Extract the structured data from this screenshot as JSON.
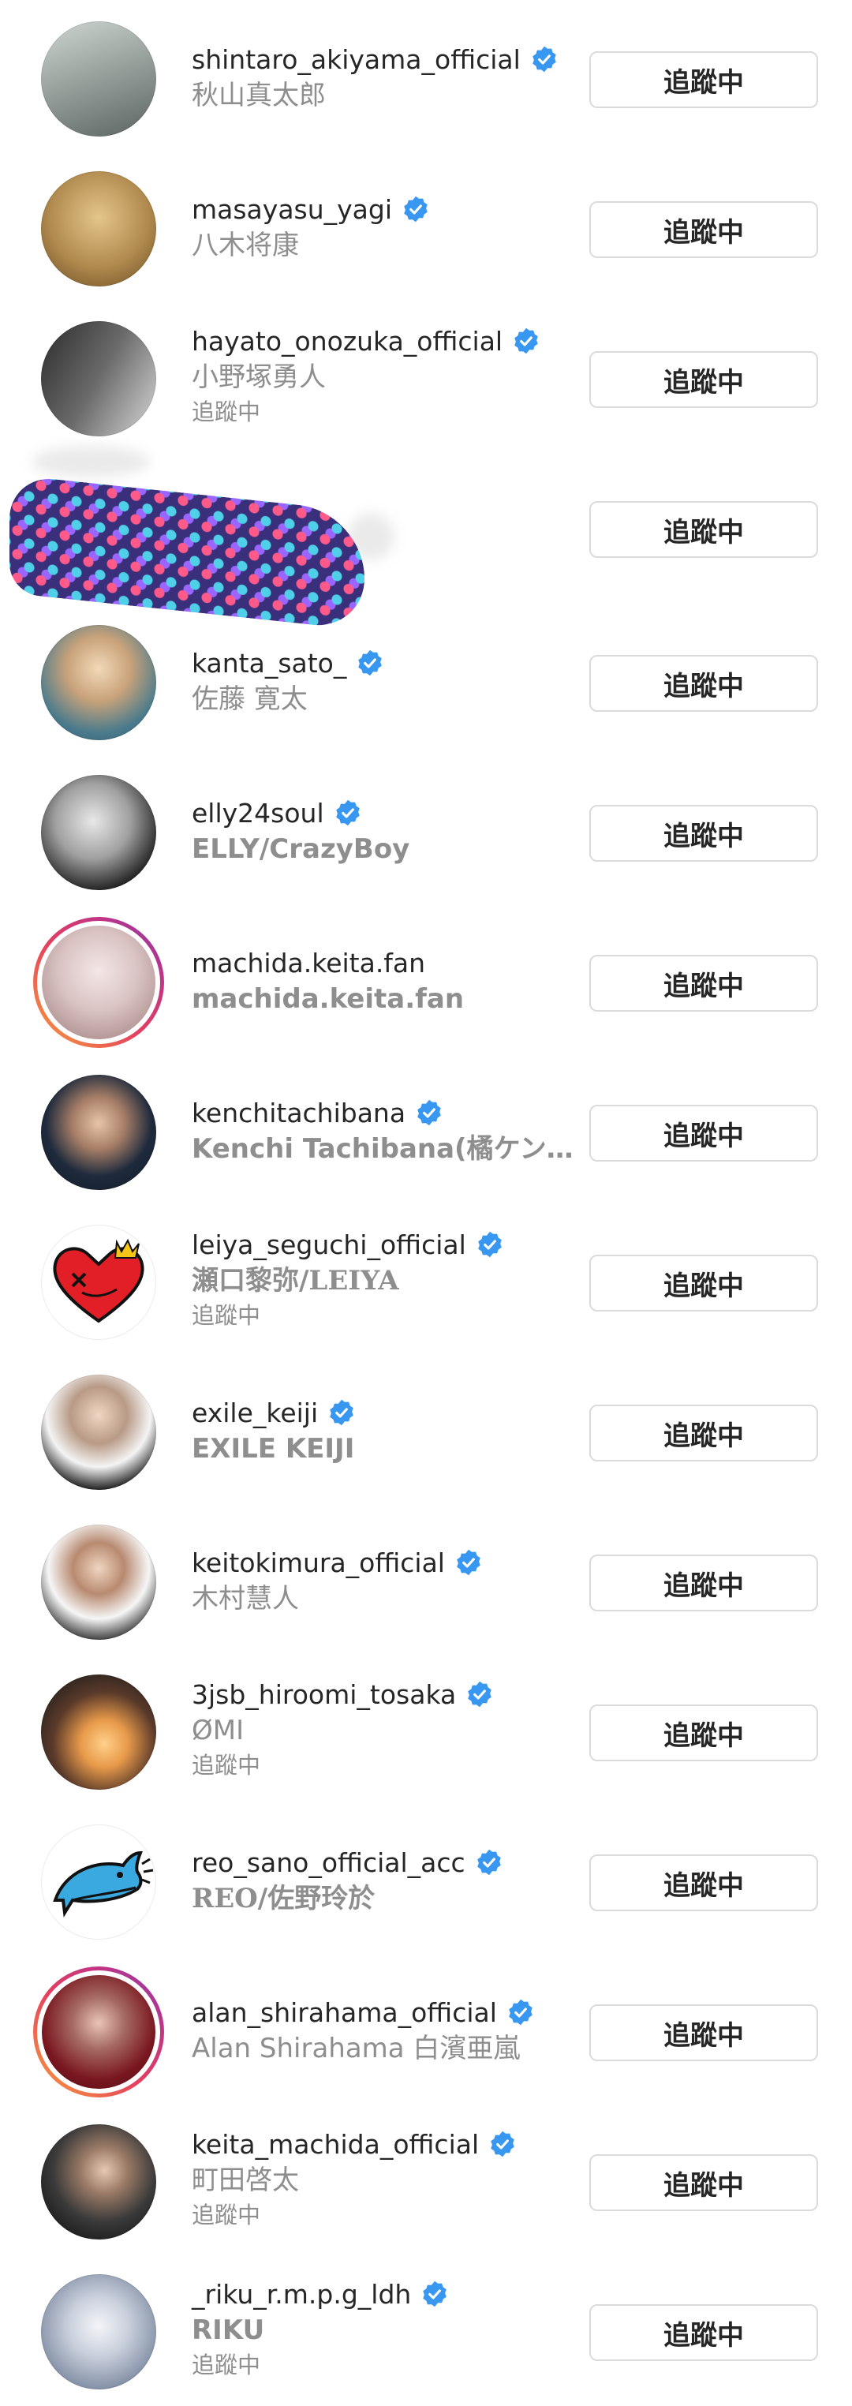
{
  "accent": {
    "verified": "#3897f0",
    "button_border": "#dbdbdb",
    "secondary_text": "#8e8e8e"
  },
  "rows": [
    {
      "username": "shintaro_akiyama_official",
      "fullname": "秋山真太郎",
      "status": "",
      "verified": true,
      "button": "追蹤中"
    },
    {
      "username": "masayasu_yagi",
      "fullname": "八木将康",
      "status": "",
      "verified": true,
      "button": "追蹤中"
    },
    {
      "username": "hayato_onozuka_official",
      "fullname": "小野塚勇人",
      "status": "追蹤中",
      "verified": true,
      "button": "追蹤中"
    },
    {
      "username": "",
      "fullname": "",
      "status": "",
      "verified": false,
      "button": "追蹤中"
    },
    {
      "username": "kanta_sato_",
      "fullname": "佐藤 寛太",
      "status": "",
      "verified": true,
      "button": "追蹤中"
    },
    {
      "username": "elly24soul",
      "fullname": "ELLY/CrazyBoy",
      "status": "",
      "verified": true,
      "button": "追蹤中"
    },
    {
      "username": "machida.keita.fan",
      "fullname": "machida.keita.fan",
      "status": "",
      "verified": false,
      "button": "追蹤中"
    },
    {
      "username": "kenchitachibana",
      "fullname": "Kenchi Tachibana(橘ケンチ)…",
      "status": "",
      "verified": true,
      "button": "追蹤中"
    },
    {
      "username": "leiya_seguchi_official",
      "fullname": "瀬口黎弥/LEIYA",
      "status": "追蹤中",
      "verified": true,
      "button": "追蹤中"
    },
    {
      "username": "exile_keiji",
      "fullname": "EXILE KEIJI",
      "status": "",
      "verified": true,
      "button": "追蹤中"
    },
    {
      "username": "keitokimura_official",
      "fullname": "木村慧人",
      "status": "",
      "verified": true,
      "button": "追蹤中"
    },
    {
      "username": "3jsb_hiroomi_tosaka",
      "fullname": "ØMI",
      "status": "追蹤中",
      "verified": true,
      "button": "追蹤中"
    },
    {
      "username": "reo_sano_official_acc",
      "fullname": "REO/佐野玲於",
      "status": "",
      "verified": true,
      "button": "追蹤中"
    },
    {
      "username": "alan_shirahama_official",
      "fullname": "Alan Shirahama 白濱亜嵐",
      "status": "",
      "verified": true,
      "button": "追蹤中"
    },
    {
      "username": "keita_machida_official",
      "fullname": "町田啓太",
      "status": "追蹤中",
      "verified": true,
      "button": "追蹤中"
    },
    {
      "username": "_riku_r.m.p.g_ldh",
      "fullname": "RIKU",
      "status": "追蹤中",
      "verified": true,
      "button": "追蹤中"
    }
  ]
}
